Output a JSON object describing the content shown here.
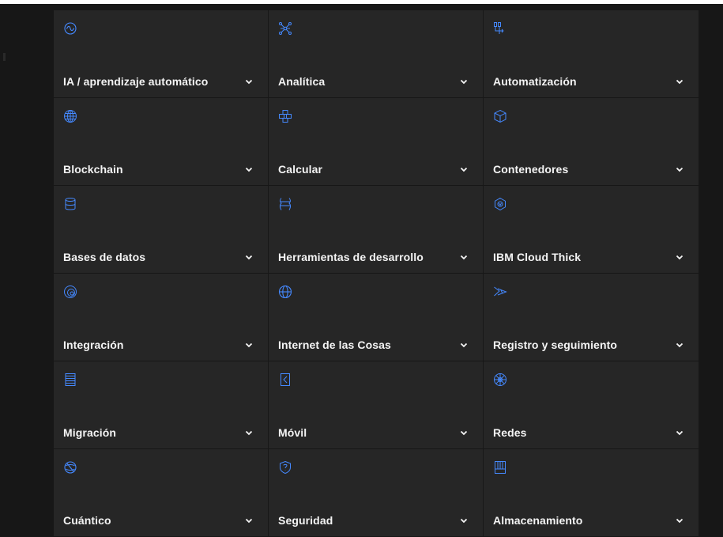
{
  "categories": [
    {
      "label": "IA / aprendizaje automático",
      "icon": "ai-brain-icon"
    },
    {
      "label": "Analítica",
      "icon": "analytics-network-icon"
    },
    {
      "label": "Automatización",
      "icon": "automation-flow-icon"
    },
    {
      "label": "Blockchain",
      "icon": "blockchain-globe-icon"
    },
    {
      "label": "Calcular",
      "icon": "compute-blocks-icon"
    },
    {
      "label": "Contenedores",
      "icon": "container-cube-icon"
    },
    {
      "label": "Bases de datos",
      "icon": "database-icon"
    },
    {
      "label": "Herramientas de desarrollo",
      "icon": "developer-tools-icon"
    },
    {
      "label": "IBM Cloud Thick",
      "icon": "cloud-hex-icon"
    },
    {
      "label": "Integración",
      "icon": "integration-icon"
    },
    {
      "label": "Internet de las Cosas",
      "icon": "iot-globe-icon"
    },
    {
      "label": "Registro y seguimiento",
      "icon": "logging-monitoring-icon"
    },
    {
      "label": "Migración",
      "icon": "migration-icon"
    },
    {
      "label": "Móvil",
      "icon": "mobile-icon"
    },
    {
      "label": "Redes",
      "icon": "network-icon"
    },
    {
      "label": "Cuántico",
      "icon": "quantum-icon"
    },
    {
      "label": "Seguridad",
      "icon": "security-shield-icon"
    },
    {
      "label": "Almacenamiento",
      "icon": "storage-icon"
    }
  ],
  "colors": {
    "background": "#171717",
    "card": "#262626",
    "text": "#f4f4f4",
    "icon": "#4589ff"
  }
}
